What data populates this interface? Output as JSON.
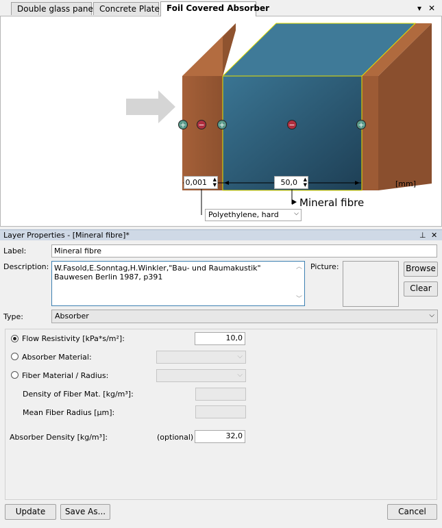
{
  "tabs": [
    {
      "label": "Double glass pane"
    },
    {
      "label": "Concrete Plate"
    },
    {
      "label": "Foil Covered Absorber"
    }
  ],
  "tab_controls": {
    "pin": "▾",
    "close": "✕"
  },
  "diagram": {
    "thickness_left": "0,001",
    "thickness_right": "50,0",
    "unit": "[mm]",
    "layer_label": "Mineral fibre",
    "foil_material": "Polyethylene, hard",
    "colors": {
      "wood": "#9a5a36",
      "absorber": "#2f5f7c",
      "arrow": "#d4d4d4"
    }
  },
  "panel": {
    "title": "Layer Properties - [Mineral fibre]*",
    "label_caption": "Label:",
    "label_value": "Mineral fibre",
    "description_caption": "Description:",
    "description_value": "W.Fasold,E.Sonntag,H.Winkler,\"Bau- und Raumakustik\" Bauwesen Berlin 1987, p391",
    "picture_caption": "Picture:",
    "browse": "Browse",
    "clear": "Clear",
    "type_caption": "Type:",
    "type_value": "Absorber",
    "flow_resistivity_label": "Flow Resistivity [kPa*s/m²]:",
    "flow_resistivity_value": "10,0",
    "absorber_material_label": "Absorber Material:",
    "fiber_material_label": "Fiber Material / Radius:",
    "density_fiber_label": "Density of Fiber Mat. [kg/m³]:",
    "mean_fiber_radius_label": "Mean Fiber Radius [µm]:",
    "absorber_density_label": "Absorber Density [kg/m³]:",
    "optional_label": "(optional)",
    "absorber_density_value": "32,0",
    "update": "Update",
    "save_as": "Save As...",
    "cancel": "Cancel"
  }
}
